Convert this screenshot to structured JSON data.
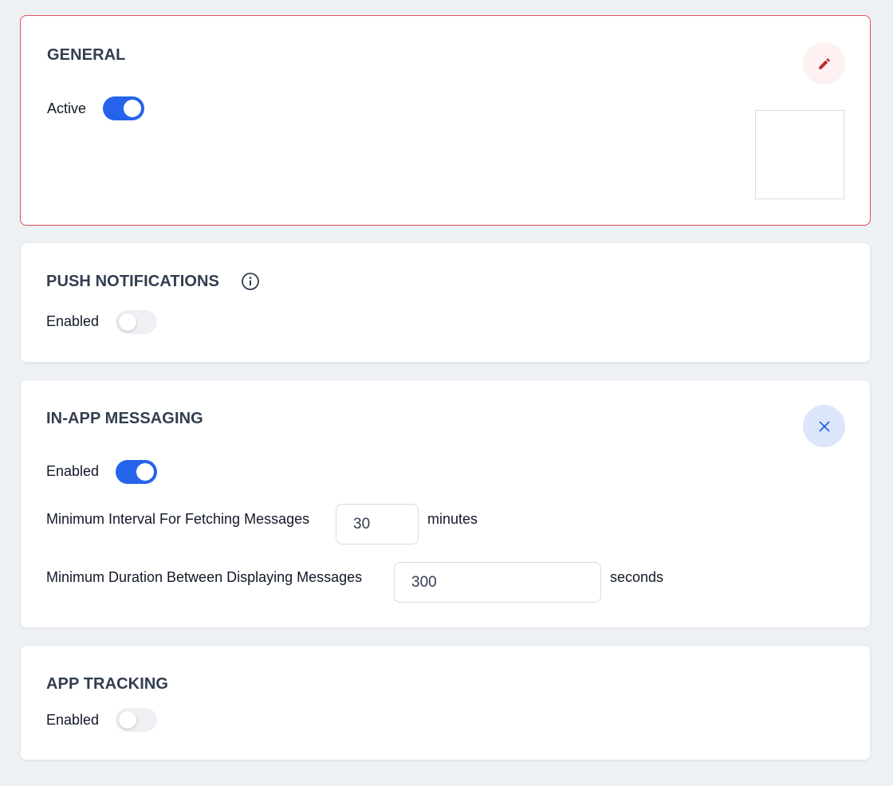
{
  "colors": {
    "toggle_on": "#2563eb",
    "toggle_off": "#eef0f3",
    "selected_border": "#e0525a",
    "edit_icon": "#c0292f",
    "close_icon": "#2563eb",
    "heading": "#323d4f"
  },
  "general": {
    "title": "GENERAL",
    "active_label": "Active",
    "active_enabled": true,
    "edit_icon": "pencil-icon"
  },
  "push_notifications": {
    "title": "PUSH NOTIFICATIONS",
    "info_icon": "info-icon",
    "enabled_label": "Enabled",
    "enabled": false
  },
  "in_app_messaging": {
    "title": "IN-APP MESSAGING",
    "close_icon": "close-icon",
    "enabled_label": "Enabled",
    "enabled": true,
    "fetch_interval_label": "Minimum Interval For Fetching Messages",
    "fetch_interval_value": "30",
    "fetch_interval_unit": "minutes",
    "display_duration_label": "Minimum Duration Between Displaying Messages",
    "display_duration_value": "300",
    "display_duration_unit": "seconds"
  },
  "app_tracking": {
    "title": "APP TRACKING",
    "enabled_label": "Enabled",
    "enabled": false
  }
}
